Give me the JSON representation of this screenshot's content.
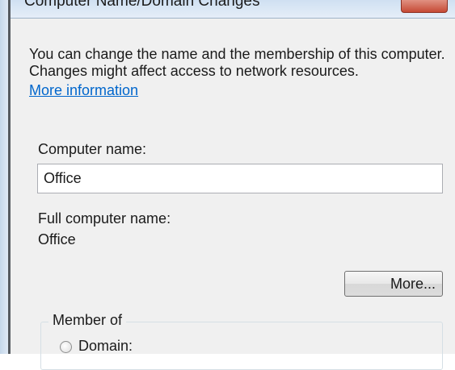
{
  "window": {
    "title": "Computer Name/Domain Changes"
  },
  "dialog": {
    "description": "You can change the name and the membership of this computer. Changes might affect access to network resources.",
    "more_info_link": "More information",
    "computer_name_label": "Computer name:",
    "computer_name_value": "Office",
    "full_name_label": "Full computer name:",
    "full_name_value": "Office",
    "more_button": "More...",
    "member_of": {
      "legend": "Member of",
      "domain_label": "Domain:",
      "domain_selected": false
    }
  },
  "colors": {
    "dialog_background": "#f0f0f0",
    "link": "#0066cc",
    "close_button": "#c64a35"
  }
}
